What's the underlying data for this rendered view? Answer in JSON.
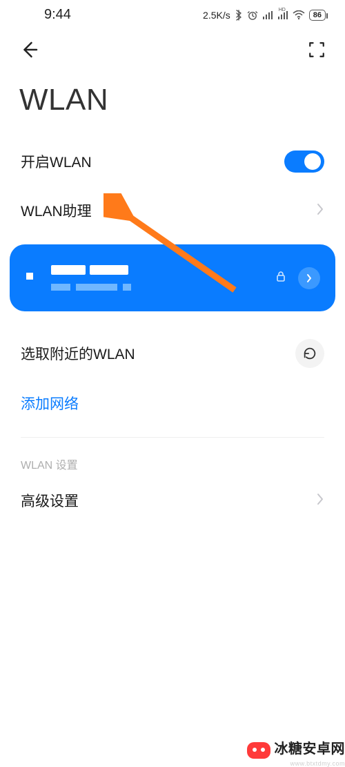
{
  "status": {
    "time": "9:44",
    "speed": "2.5K/s",
    "battery": "86"
  },
  "page": {
    "title": "WLAN"
  },
  "rows": {
    "enable_wlan_label": "开启WLAN",
    "wlan_assistant_label": "WLAN助理"
  },
  "nearby": {
    "label": "选取附近的WLAN",
    "add_network": "添加网络"
  },
  "settings_section": {
    "label": "WLAN 设置",
    "advanced": "高级设置"
  },
  "watermark": {
    "text": "冰糖安卓网",
    "sub": "www.btxtdmy.com"
  },
  "icons": {
    "back": "back-icon",
    "scan": "scan-icon",
    "lock": "lock-icon",
    "refresh": "refresh-icon",
    "chevron": "chevron-right-icon",
    "wifi": "wifi-icon",
    "bluetooth": "bluetooth-icon",
    "alarm": "alarm-icon",
    "signal": "signal-icon"
  },
  "colors": {
    "accent": "#0a7cff",
    "arrow": "#ff7a1a"
  }
}
